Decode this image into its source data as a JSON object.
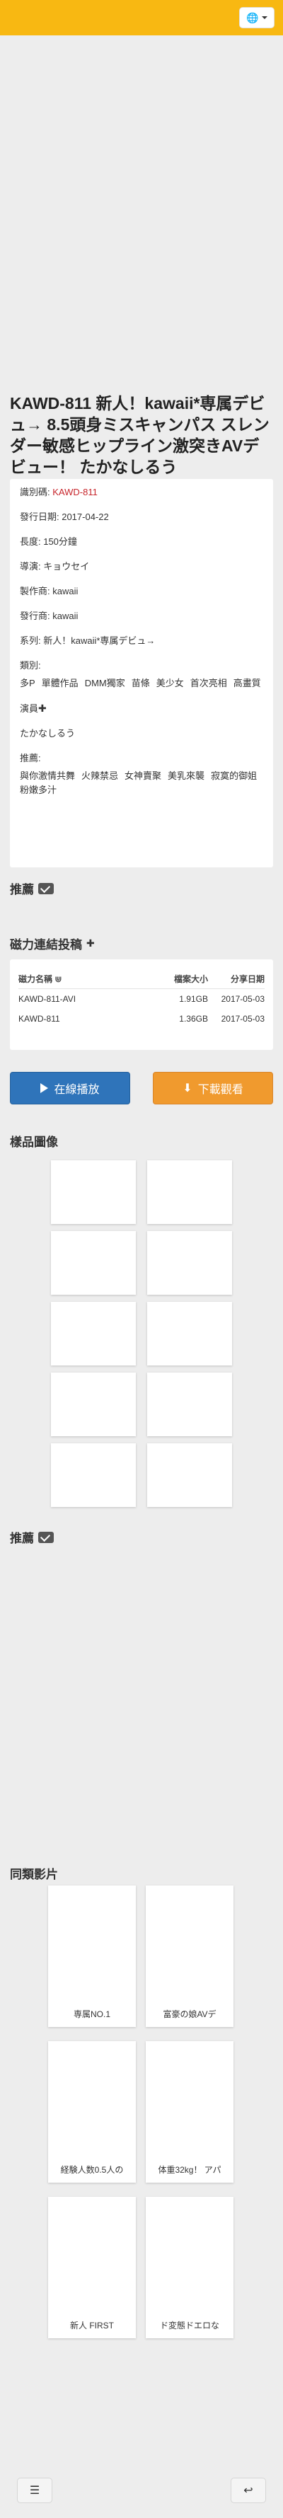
{
  "topbar": {
    "color": "#f8b812",
    "globe_icon": "globe-icon"
  },
  "title": "KAWD-811 新人！kawaii*専属デビュ→ 8.5頭身ミスキャンパス スレンダー敏感ヒップライン激突きAVデビュー！ たかなしるう",
  "info": {
    "id_label": "識別碼:",
    "id_value": "KAWD-811",
    "date": "發行日期: 2017-04-22",
    "length": "長度: 150分鐘",
    "director": "導演: キョウセイ",
    "maker": "製作商: kawaii",
    "publisher": "發行商: kawaii",
    "series": "系列: 新人！kawaii*専属デビュ→",
    "genre_label": "類別:",
    "genres": [
      "多P",
      "單體作品",
      "DMM獨家",
      "苗條",
      "美少女",
      "首次亮相",
      "高畫質"
    ],
    "actor_label": "演員",
    "actor": "たかなしるう",
    "recommend_label": "推薦:",
    "recommends": [
      "與你激情共舞",
      "火辣禁忌",
      "女神賣聚",
      "美乳來襲",
      "寂寞的御姐",
      "粉嫩多汁"
    ]
  },
  "section_recommend1": "推薦",
  "magnet": {
    "title": "磁力連結投稿",
    "headers": {
      "name": "磁力名稱",
      "size": "檔案大小",
      "date": "分享日期"
    },
    "rows": [
      {
        "name": "KAWD-811-AVI",
        "size": "1.91GB",
        "date": "2017-05-03"
      },
      {
        "name": "KAWD-811",
        "size": "1.36GB",
        "date": "2017-05-03"
      }
    ]
  },
  "buttons": {
    "play": "在線播放",
    "download": "下載觀看"
  },
  "samples_title": "樣品圖像",
  "section_recommend2": "推薦",
  "similar_title": "同類影片",
  "similar": [
    "専属NO.1",
    "富豪の娘AVデ",
    "経験人数0.5人の",
    "体重32kg！ アパ",
    "新人 FIRST",
    "ド変態ドエロな"
  ],
  "bottom": {
    "menu_icon": "menu-icon",
    "back_icon": "back-icon"
  }
}
